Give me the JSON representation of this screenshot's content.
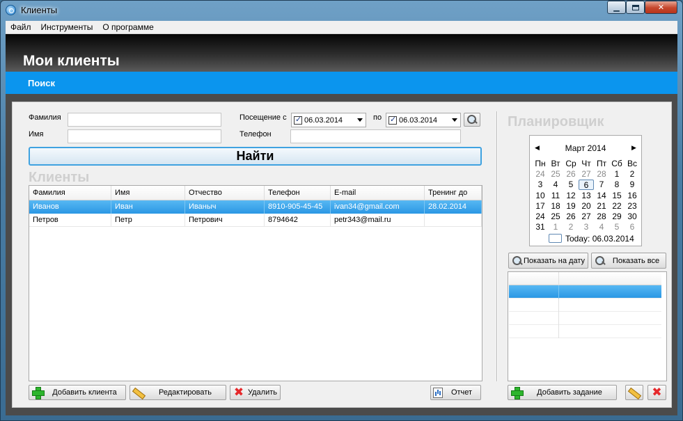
{
  "window": {
    "title": "Клиенты"
  },
  "menu": [
    "Файл",
    "Инструменты",
    "О программе"
  ],
  "page": {
    "heading": "Мои клиенты",
    "band_title": "Поиск"
  },
  "search": {
    "surname_label": "Фамилия",
    "surname_value": "",
    "name_label": "Имя",
    "name_value": "",
    "visit_label": "Посещение с",
    "visit_from": "06.03.2014",
    "to_label": "по",
    "visit_to": "06.03.2014",
    "phone_label": "Телефон",
    "phone_value": "",
    "find_button": "Найти"
  },
  "clients": {
    "title": "Клиенты",
    "columns": [
      "Фамилия",
      "Имя",
      "Отчество",
      "Телефон",
      "E-mail",
      "Тренинг до"
    ],
    "rows": [
      [
        "Иванов",
        "Иван",
        "Иваныч",
        "8910-905-45-45",
        "ivan34@gmail.com",
        "28.02.2014"
      ],
      [
        "Петров",
        "Петр",
        "Петрович",
        "8794642",
        "petr343@mail.ru",
        ""
      ]
    ],
    "selected_row": 0
  },
  "actions": {
    "add": "Добавить клиента",
    "edit": "Редактировать",
    "delete": "Удалить",
    "report": "Отчет"
  },
  "planner": {
    "title": "Планировщик",
    "month": "Март 2014",
    "weekdays": [
      "Пн",
      "Вт",
      "Ср",
      "Чт",
      "Пт",
      "Сб",
      "Вс"
    ],
    "weeks": [
      [
        "24",
        "25",
        "26",
        "27",
        "28",
        "1",
        "2"
      ],
      [
        "3",
        "4",
        "5",
        "6",
        "7",
        "8",
        "9"
      ],
      [
        "10",
        "11",
        "12",
        "13",
        "14",
        "15",
        "16"
      ],
      [
        "17",
        "18",
        "19",
        "20",
        "21",
        "22",
        "23"
      ],
      [
        "24",
        "25",
        "26",
        "27",
        "28",
        "29",
        "30"
      ],
      [
        "31",
        "1",
        "2",
        "3",
        "4",
        "5",
        "6"
      ]
    ],
    "today_label": "Today: 06.03.2014",
    "show_on_date": "Показать на дату",
    "show_all": "Показать все",
    "add_task": "Добавить задание"
  },
  "colors": {
    "accent_band": "#0b95ee",
    "selection": "#2b97e4",
    "header_dark": "#050505"
  }
}
